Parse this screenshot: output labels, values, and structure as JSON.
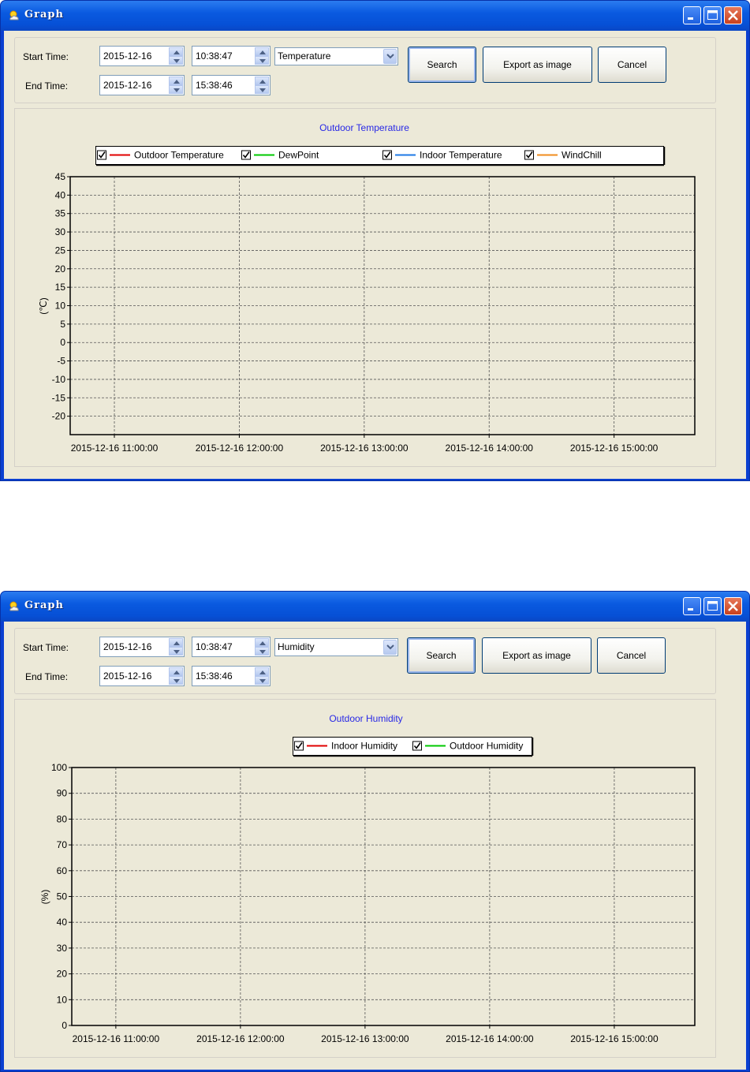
{
  "windows": [
    {
      "title": "Graph",
      "start_time_label": "Start Time:",
      "end_time_label": "End Time:",
      "start_date": "2015-12-16",
      "start_time": "10:38:47",
      "end_date": "2015-12-16",
      "end_time": "15:38:46",
      "type_selected": "Temperature",
      "search_label": "Search",
      "export_label": "Export as image",
      "cancel_label": "Cancel",
      "chart_title": "Outdoor Temperature",
      "ylabel": "(℃)",
      "legend": [
        {
          "name": "Outdoor Temperature",
          "color": "#e00000",
          "checked": true
        },
        {
          "name": "DewPoint",
          "color": "#00c800",
          "checked": true
        },
        {
          "name": "Indoor Temperature",
          "color": "#1e78e6",
          "checked": true
        },
        {
          "name": "WindChill",
          "color": "#f08c1e",
          "checked": true
        }
      ],
      "ticks": [
        "45",
        "40",
        "35",
        "30",
        "25",
        "20",
        "15",
        "10",
        "5",
        "0",
        "-5",
        "-10",
        "-15",
        "-20"
      ],
      "xticks": [
        "2015-12-16 11:00:00",
        "2015-12-16 12:00:00",
        "2015-12-16 13:00:00",
        "2015-12-16 14:00:00",
        "2015-12-16 15:00:00"
      ]
    },
    {
      "title": "Graph",
      "start_time_label": "Start Time:",
      "end_time_label": "End Time:",
      "start_date": "2015-12-16",
      "start_time": "10:38:47",
      "end_date": "2015-12-16",
      "end_time": "15:38:46",
      "type_selected": "Humidity",
      "search_label": "Search",
      "export_label": "Export as image",
      "cancel_label": "Cancel",
      "chart_title": "Outdoor Humidity",
      "ylabel": "(%)",
      "legend": [
        {
          "name": "Indoor Humidity",
          "color": "#e00000",
          "checked": true
        },
        {
          "name": "Outdoor Humidity",
          "color": "#00c800",
          "checked": true
        }
      ],
      "ticks": [
        "100",
        "90",
        "80",
        "70",
        "60",
        "50",
        "40",
        "30",
        "20",
        "10",
        "0"
      ],
      "xticks": [
        "2015-12-16 11:00:00",
        "2015-12-16 12:00:00",
        "2015-12-16 13:00:00",
        "2015-12-16 14:00:00",
        "2015-12-16 15:00:00"
      ]
    }
  ],
  "chart_data": [
    {
      "type": "line",
      "title": "Outdoor Temperature",
      "ylabel": "(℃)",
      "xlabel": "",
      "ylim": [
        -25,
        45
      ],
      "yticks": [
        45,
        40,
        35,
        30,
        25,
        20,
        15,
        10,
        5,
        0,
        -5,
        -10,
        -15,
        -20
      ],
      "x_tick_labels": [
        "2015-12-16 11:00:00",
        "2015-12-16 12:00:00",
        "2015-12-16 13:00:00",
        "2015-12-16 14:00:00",
        "2015-12-16 15:00:00"
      ],
      "xlim": [
        "2015-12-16 10:38:47",
        "2015-12-16 15:38:46"
      ],
      "grid": true,
      "legend_position": "top",
      "series": [
        {
          "name": "Outdoor Temperature",
          "color": "#e00000",
          "values": []
        },
        {
          "name": "DewPoint",
          "color": "#00c800",
          "values": []
        },
        {
          "name": "Indoor Temperature",
          "color": "#1e78e6",
          "values": []
        },
        {
          "name": "WindChill",
          "color": "#f08c1e",
          "values": []
        }
      ]
    },
    {
      "type": "line",
      "title": "Outdoor Humidity",
      "ylabel": "(%)",
      "xlabel": "",
      "ylim": [
        0,
        100
      ],
      "yticks": [
        100,
        90,
        80,
        70,
        60,
        50,
        40,
        30,
        20,
        10,
        0
      ],
      "x_tick_labels": [
        "2015-12-16 11:00:00",
        "2015-12-16 12:00:00",
        "2015-12-16 13:00:00",
        "2015-12-16 14:00:00",
        "2015-12-16 15:00:00"
      ],
      "xlim": [
        "2015-12-16 10:38:47",
        "2015-12-16 15:38:46"
      ],
      "grid": true,
      "legend_position": "top",
      "series": [
        {
          "name": "Indoor Humidity",
          "color": "#e00000",
          "values": []
        },
        {
          "name": "Outdoor Humidity",
          "color": "#00c800",
          "values": []
        }
      ]
    }
  ]
}
